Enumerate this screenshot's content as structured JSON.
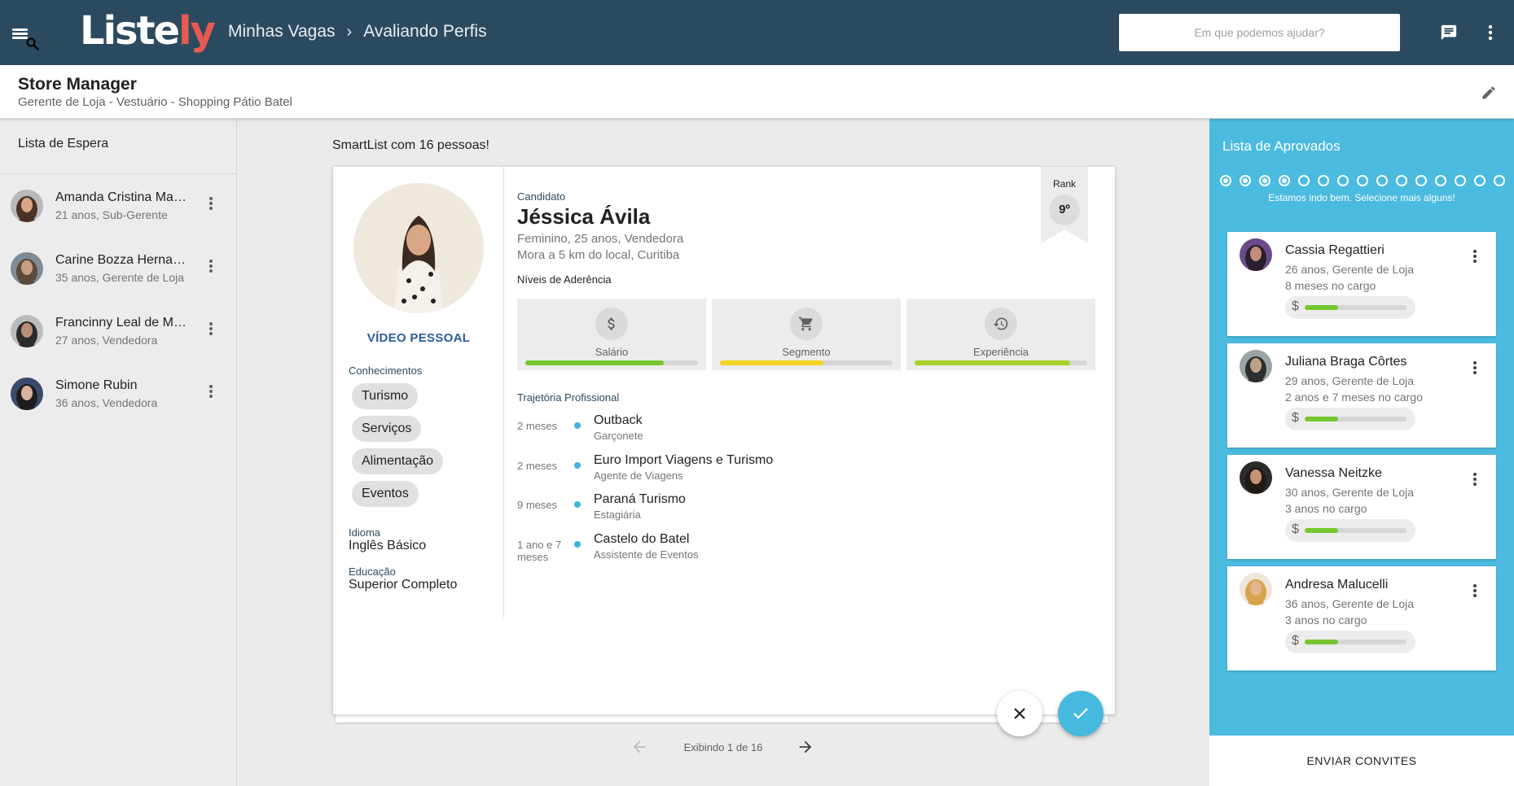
{
  "topbar": {
    "logo_main": "Liste",
    "logo_accent": "ly",
    "breadcrumb": [
      "Minhas Vagas",
      "Avaliando Perfis"
    ],
    "search_placeholder": "Em que podemos ajudar?",
    "icons": [
      "menu-icon",
      "search-icon",
      "chat-icon",
      "more-vertical-icon"
    ]
  },
  "job": {
    "title": "Store Manager",
    "subtitle": "Gerente de Loja - Vestuário - Shopping Pátio Batel"
  },
  "waiting": {
    "title": "Lista de Espera",
    "items": [
      {
        "name": "Amanda Cristina Mar…",
        "info": "21 anos, Sub-Gerente"
      },
      {
        "name": "Carine Bozza Hernan…",
        "info": "35 anos, Gerente de Loja"
      },
      {
        "name": "Francinny Leal de Me…",
        "info": "27 anos, Vendedora"
      },
      {
        "name": "Simone Rubin",
        "info": "36 anos, Vendedora"
      }
    ]
  },
  "smartlist": {
    "title": "SmartList com 16 pessoas!",
    "pager_text": "Exibindo 1 de 16"
  },
  "candidate": {
    "label": "Candidato",
    "name": "Jéssica Ávila",
    "info": "Feminino, 25 anos, Vendedora",
    "location": "Mora a 5 km do local, Curitiba",
    "video_label": "VÍDEO PESSOAL",
    "rank_label": "Rank",
    "rank_value": "9º",
    "knowledge_label": "Conhecimentos",
    "knowledge": [
      "Turismo",
      "Serviços",
      "Alimentação",
      "Eventos"
    ],
    "language_label": "Idioma",
    "language": "Inglês Básico",
    "education_label": "Educação",
    "education": "Superior Completo",
    "adherence_label": "Níveis de Aderência",
    "adherence": [
      {
        "label": "Salário",
        "icon": "dollar-icon",
        "level": 0.8,
        "color": "#76c730"
      },
      {
        "label": "Segmento",
        "icon": "cart-icon",
        "level": 0.6,
        "color": "#f3d21f"
      },
      {
        "label": "Experiência",
        "icon": "history-icon",
        "level": 0.9,
        "color": "#a7d02b"
      }
    ],
    "trajectory_label": "Trajetória Profissional",
    "trajectory": [
      {
        "duration": "2 meses",
        "company": "Outback",
        "role": "Garçonete"
      },
      {
        "duration": "2 meses",
        "company": "Euro Import Viagens e Turismo",
        "role": "Agente de Viagens"
      },
      {
        "duration": "9 meses",
        "company": "Paraná Turismo",
        "role": "Estagiária"
      },
      {
        "duration": "1 ano e 7 meses",
        "company": "Castelo do Batel",
        "role": "Assistente de Eventos"
      }
    ]
  },
  "approved": {
    "title": "Lista de Aprovados",
    "message": "Estamos indo bem. Selecione mais alguns!",
    "progress_filled": 4,
    "progress_total": 15,
    "items": [
      {
        "name": "Cassia Regattieri",
        "info": "26 anos, Gerente de Loja",
        "tenure": "8 meses no cargo",
        "salary_level": 0.33
      },
      {
        "name": "Juliana Braga Côrtes",
        "info": "29 anos, Gerente de Loja",
        "tenure": "2 anos e 7 meses no cargo",
        "salary_level": 0.33
      },
      {
        "name": "Vanessa Neitzke",
        "info": "30 anos, Gerente de Loja",
        "tenure": "3 anos no cargo",
        "salary_level": 0.33
      },
      {
        "name": "Andresa Malucelli",
        "info": "36 anos, Gerente de Loja",
        "tenure": "3 anos no cargo",
        "salary_level": 0.33
      }
    ],
    "invite_label": "ENVIAR CONVITES"
  },
  "colors": {
    "topbar": "#2c4a5f",
    "accent": "#4bbbdf",
    "logo_accent": "#e85a4f",
    "link": "#2a5d9b"
  }
}
